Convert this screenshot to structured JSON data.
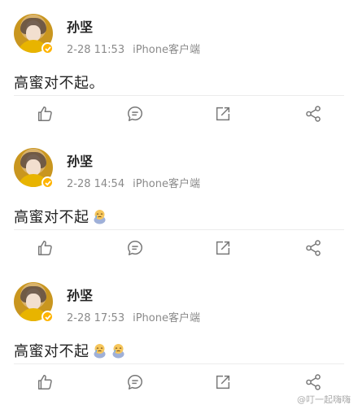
{
  "posts": [
    {
      "author": "孙坚",
      "time": "2-28 11:53",
      "source": "iPhone客户端",
      "text": "高蜜对不起。",
      "emoji_count": 0
    },
    {
      "author": "孙坚",
      "time": "2-28 14:54",
      "source": "iPhone客户端",
      "text": "高蜜对不起",
      "emoji_count": 1
    },
    {
      "author": "孙坚",
      "time": "2-28 17:53",
      "source": "iPhone客户端",
      "text": "高蜜对不起",
      "emoji_count": 2
    }
  ],
  "icons": {
    "like": "thumbs-up-icon",
    "comment": "comment-icon",
    "repost": "share-box-icon",
    "share": "share-network-icon",
    "verified": "verified-badge-icon",
    "emoji": "crying-emoji-icon"
  },
  "colors": {
    "verified_badge": "#ffb400",
    "meta_text": "#8a8a8a",
    "icon_stroke": "#777777"
  },
  "watermark": "@叮一起嗨嗨"
}
